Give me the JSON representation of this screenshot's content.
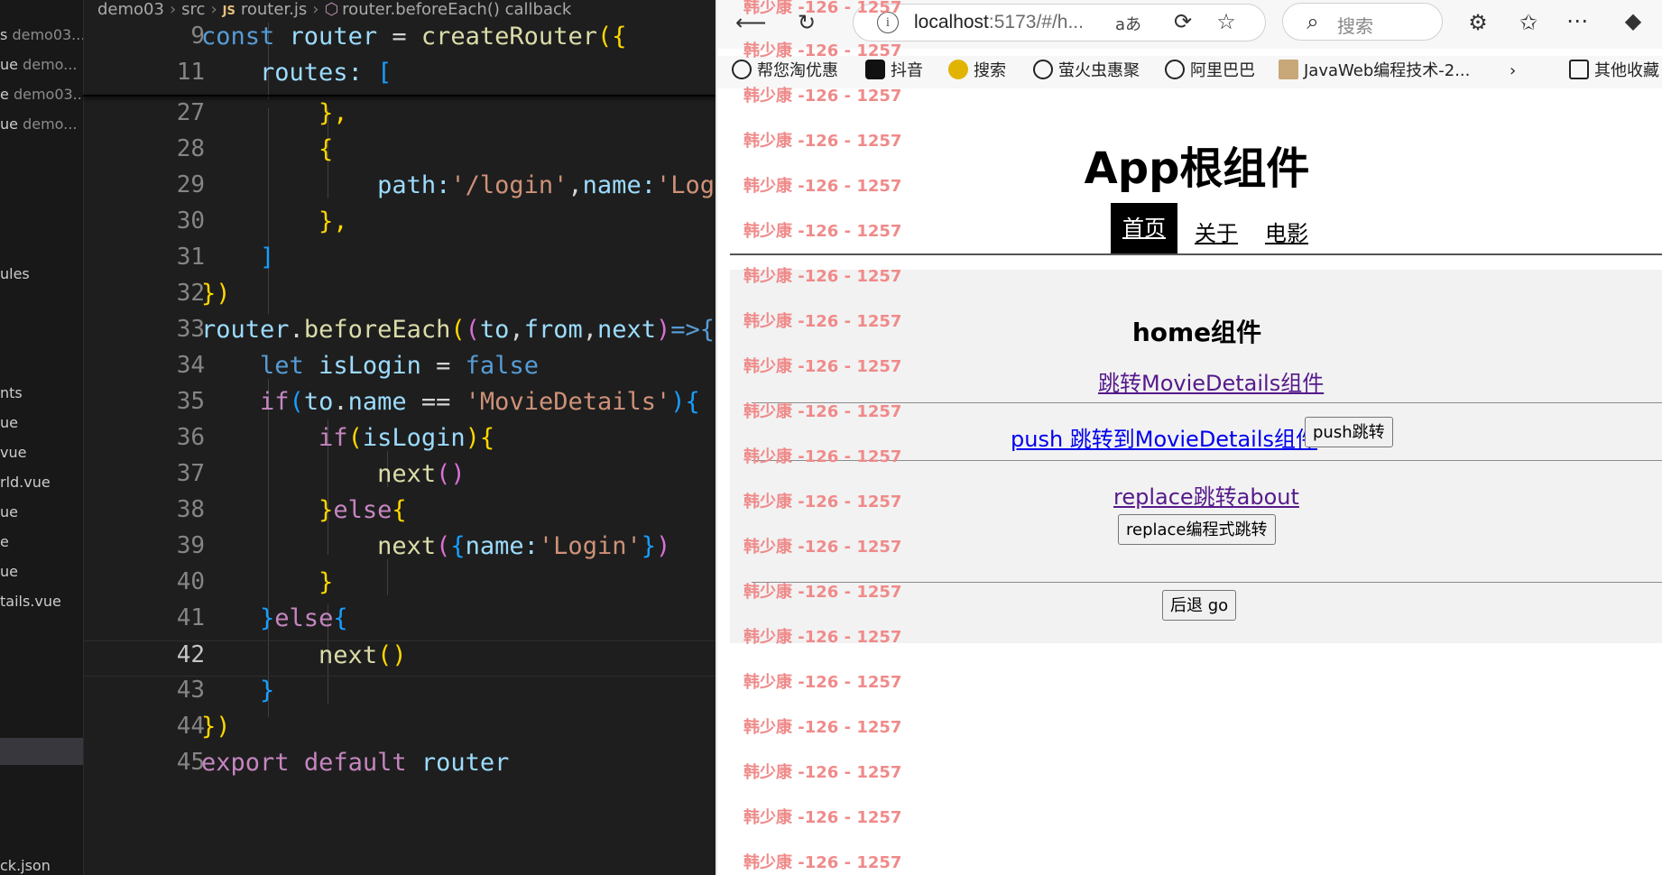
{
  "editor": {
    "breadcrumb": {
      "project": "demo03",
      "folder": "src",
      "file_type_badge": "JS",
      "file": "router.js",
      "symbol": "router.beforeEach() callback"
    },
    "explorer": [
      {
        "prefix": "s",
        "name": "demo03..."
      },
      {
        "prefix": "ue",
        "name": "demo..."
      },
      {
        "prefix": "e",
        "name": "demo03..."
      },
      {
        "prefix": "ue",
        "name": "demo..."
      },
      {
        "prefix": "",
        "name": "ules"
      },
      {
        "prefix": "",
        "name": "nts"
      },
      {
        "prefix": "",
        "name": "ue"
      },
      {
        "prefix": "",
        "name": "vue"
      },
      {
        "prefix": "",
        "name": "rld.vue"
      },
      {
        "prefix": "",
        "name": "ue"
      },
      {
        "prefix": "",
        "name": "e"
      },
      {
        "prefix": "",
        "name": "ue"
      },
      {
        "prefix": "",
        "name": "tails.vue"
      },
      {
        "prefix": "",
        "name": ""
      },
      {
        "prefix": "",
        "name": "ck.json"
      }
    ],
    "line_numbers": [
      "9",
      "11",
      "27",
      "28",
      "29",
      "30",
      "31",
      "32",
      "33",
      "34",
      "35",
      "36",
      "37",
      "38",
      "39",
      "40",
      "41",
      "42",
      "43",
      "44",
      "45"
    ],
    "current_line": "42",
    "code": {
      "l9": {
        "kw": "const",
        "var": "router",
        "eq": "=",
        "fn": "createRouter",
        "open": "({"
      },
      "l11": {
        "prop": "routes:",
        "open": "["
      },
      "l27": {
        "text": "},"
      },
      "l28": {
        "text": "{"
      },
      "l29": {
        "prop": "path:",
        "str": "'/login'",
        "comma": ",",
        "prop2": "name:",
        "str2": "'Log"
      },
      "l30": {
        "text": "},"
      },
      "l31": {
        "text": "]"
      },
      "l32": {
        "text": "})"
      },
      "l33": {
        "obj": "router",
        "dot": ".",
        "fn": "beforeEach",
        "p1": "(",
        "p2": "(",
        "a1": "to",
        "c1": ",",
        "a2": "from",
        "c2": ",",
        "a3": "next",
        "p3": ")",
        "arrow": "=>{"
      },
      "l34": {
        "kw": "let",
        "var": "isLogin",
        "eq": "=",
        "val": "false"
      },
      "l35": {
        "kw": "if",
        "p": "(",
        "obj": "to",
        "dot": ".",
        "prop": "name",
        "eq": "==",
        "str": "'MovieDetails'",
        "close": "){"
      },
      "l36": {
        "kw": "if",
        "p": "(",
        "var": "isLogin",
        "close": "){"
      },
      "l37": {
        "fn": "next",
        "paren": "()"
      },
      "l38": {
        "close": "}",
        "kw": "else",
        "open": "{"
      },
      "l39": {
        "fn": "next",
        "p": "(",
        "b": "{",
        "prop": "name:",
        "str": "'Login'",
        "bc": "}",
        "pc": ")"
      },
      "l40": {
        "text": "}"
      },
      "l41": {
        "close": "}",
        "kw": "else",
        "open": "{"
      },
      "l42": {
        "fn": "next",
        "paren": "()"
      },
      "l43": {
        "text": "}"
      },
      "l44": {
        "text": "})"
      },
      "l45": {
        "kw": "export",
        "kw2": "default",
        "var": "router"
      }
    }
  },
  "browser": {
    "url_host": "localhost",
    "url_rest": ":5173/#/h...",
    "read_aloud": "aあ",
    "search_placeholder": "搜索",
    "bookmarks": [
      "帮您淘优惠",
      "抖音",
      "搜索",
      "萤火虫惠聚",
      "阿里巴巴",
      "JavaWeb编程技术-2...",
      "其他收藏"
    ],
    "page": {
      "app_title": "App根组件",
      "nav": [
        "首页",
        "关于",
        "电影"
      ],
      "home_title": "home组件",
      "link_movie": "跳转MovieDetails组件",
      "push_link": "push 跳转到MovieDetails组件",
      "push_button": "push跳转",
      "replace_link": "replace跳转about",
      "replace_button": "replace编程式跳转",
      "back_button": "后退 go"
    },
    "watermark": "韩少康 -126 - 1257"
  },
  "colors": {
    "editor_bg": "#1e1e1e",
    "watermark": "#f08a8a",
    "nav_active_bg": "#000000",
    "home_bg": "#f2f2f2",
    "visited_link": "#551a8b",
    "link": "#0000ee"
  }
}
